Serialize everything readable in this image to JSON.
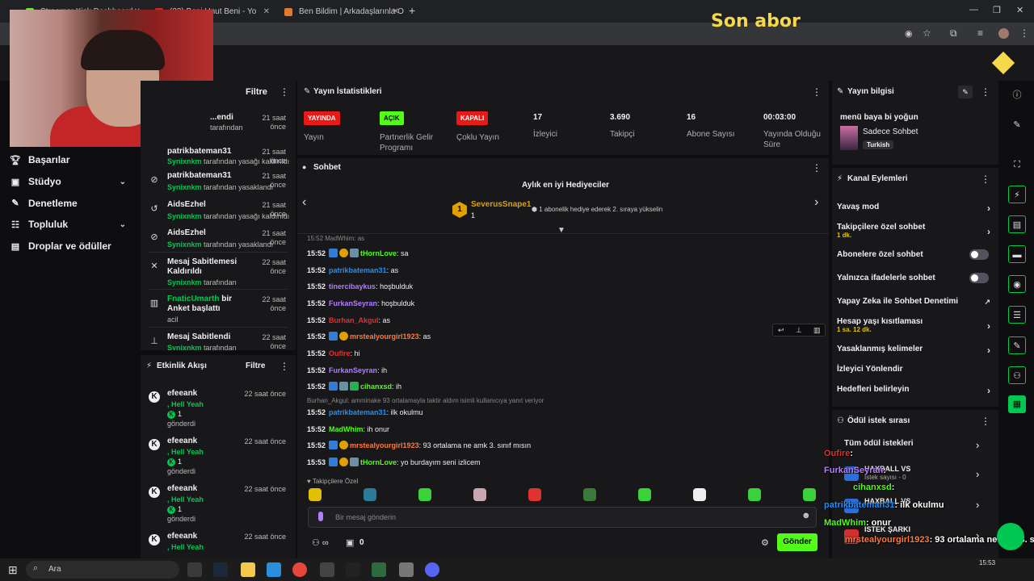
{
  "browser": {
    "tabs": [
      {
        "title": "Streamer Kick Dashboard"
      },
      {
        "title": "(23) Beni Unut Beni - Yo"
      },
      {
        "title": "Ben Bildim | Arkadaşlarınla Onl"
      }
    ],
    "add_tab": "+"
  },
  "overlay_title": "Son abor",
  "left_nav": {
    "items": [
      {
        "label": "Başarılar"
      },
      {
        "label": "Stüdyo"
      },
      {
        "label": "Denetleme"
      },
      {
        "label": "Topluluk"
      },
      {
        "label": "Droplar ve ödüller"
      }
    ]
  },
  "mod_actions": {
    "filter": "Filtre",
    "items": [
      {
        "title": "...endi",
        "time": "21 saat önce",
        "actor": "Synixnkm",
        "suffix": "tarafından"
      },
      {
        "title": "patrikbateman31",
        "time": "21 saat önce",
        "actor": "Synixnkm",
        "suffix": "tarafından yasağı kaldırıldı"
      },
      {
        "title": "patrikbateman31",
        "time": "21 saat önce",
        "actor": "Synixnkm",
        "suffix": "tarafından yasaklandı"
      },
      {
        "title": "AidsEzhel",
        "time": "21 saat önce",
        "actor": "Synixnkm",
        "suffix": "tarafından yasağı kaldırıldı"
      },
      {
        "title": "AidsEzhel",
        "time": "21 saat önce",
        "actor": "Synixnkm",
        "suffix": "tarafından yasaklandı"
      },
      {
        "title": "Mesaj Sabitlemesi Kaldırıldı",
        "time": "22 saat önce",
        "actor": "Synixnkm",
        "suffix": "tarafından"
      },
      {
        "title_green": "FnaticUmarth",
        "title": " bir Anket başlattı",
        "time": "22 saat önce",
        "extra": "acil"
      },
      {
        "title": "Mesaj Sabitlendi",
        "time": "22 saat önce",
        "actor": "Synixnkm",
        "suffix": "tarafından"
      }
    ]
  },
  "activity": {
    "title": "Etkinlik Akışı",
    "filter": "Filtre",
    "items": [
      {
        "name": "efeeank",
        "msg": ", Hell Yeah",
        "amount": "1",
        "label": "gönderdi",
        "time": "22 saat önce"
      },
      {
        "name": "efeeank",
        "msg": ", Hell Yeah",
        "amount": "1",
        "label": "gönderdi",
        "time": "22 saat önce"
      },
      {
        "name": "efeeank",
        "msg": ", Hell Yeah",
        "amount": "1",
        "label": "gönderdi",
        "time": "22 saat önce"
      },
      {
        "name": "efeeank",
        "msg": ", Hell Yeah",
        "amount": "1",
        "label": "gönderdi",
        "time": "22 saat önce"
      }
    ]
  },
  "stats": {
    "title": "Yayın İstatistikleri",
    "items": [
      {
        "badge": "YAYINDA",
        "label": "Yayın",
        "color": "#e91916"
      },
      {
        "badge": "AÇIK",
        "label": "Partnerlik Gelir Programı",
        "color": "#53fc18"
      },
      {
        "badge": "KAPALI",
        "label": "Çoklu Yayın",
        "color": "#e91916"
      },
      {
        "value": "17",
        "label": "İzleyici"
      },
      {
        "value": "3.690",
        "label": "Takipçi"
      },
      {
        "value": "16",
        "label": "Abone Sayısı"
      },
      {
        "value": "00:03:00",
        "label": "Yayında Olduğu Süre"
      }
    ]
  },
  "chat": {
    "title": "Sohbet",
    "gifters_title": "Aylık en iyi Hediyeciler",
    "top_gifter": "SeverusSnape1",
    "top_gifter_count": "1",
    "gifter_note": "1 abonelik hediye ederek 2. sıraya yükselin",
    "partial_top": "15:52 MadWhim: as",
    "messages": [
      {
        "time": "15:52",
        "user": "tHornLove",
        "color": "#53fc18",
        "text": ": sa",
        "badges": [
          "mod",
          "sub",
          "other"
        ]
      },
      {
        "time": "15:52",
        "user": "patrikbateman31",
        "color": "#1e90ff",
        "text": ": as",
        "badges": []
      },
      {
        "time": "15:52",
        "user": "tinercibaykus",
        "color": "#b57cff",
        "text": ": hoşbulduk",
        "badges": []
      },
      {
        "time": "15:52",
        "user": "FurkanSeyran",
        "color": "#b57cff",
        "text": ": hoşbulduk",
        "badges": []
      },
      {
        "time": "15:52",
        "user": "Burhan_Akgul",
        "color": "#e0322f",
        "text": ": as",
        "badges": []
      },
      {
        "time": "15:52",
        "user": "mrstealyourgirl1923",
        "color": "#ff7a3d",
        "text": ": as",
        "badges": [
          "mod",
          "sub"
        ]
      },
      {
        "time": "15:52",
        "user": "Oufire",
        "color": "#e0322f",
        "text": ": hi",
        "badges": []
      },
      {
        "time": "15:52",
        "user": "FurkanSeyran",
        "color": "#b57cff",
        "text": ": ih",
        "badges": []
      },
      {
        "time": "15:52",
        "user": "cihanxsd",
        "color": "#53fc18",
        "text": ": ih",
        "badges": [
          "mod",
          "other",
          "vip"
        ]
      },
      {
        "time": "15:52",
        "user": "patrikbateman31",
        "color": "#1e90ff",
        "text": ": ilk okulmu",
        "badges": [],
        "reply": "Burhan_Akgul: amminake 93 ortalamayla taktir aldım isimli kullanıcıya yanıt veriyor"
      },
      {
        "time": "15:52",
        "user": "MadWhim",
        "color": "#53fc18",
        "text": ": ih onur",
        "badges": []
      },
      {
        "time": "15:52",
        "user": "mrstealyourgirl1923",
        "color": "#ff7a3d",
        "text": ": 93 ortalama ne amk 3. sınıf mısın",
        "badges": [
          "mod",
          "sub"
        ]
      },
      {
        "time": "15:53",
        "user": "tHornLove",
        "color": "#53fc18",
        "text": ": yo burdayım seni izlicem",
        "badges": [
          "mod",
          "sub",
          "other"
        ]
      }
    ],
    "followers_only_label": "Takipçilere Özel",
    "input_placeholder": "Bir mesaj gönderin",
    "points": "0",
    "send": "Gönder"
  },
  "stream_info": {
    "title": "Yayın bilgisi",
    "stream_title": "menü baya bi yoğun",
    "category": "Sadece Sohbet",
    "tag": "Turkish"
  },
  "channel_actions": {
    "title": "Kanal Eylemleri",
    "items": [
      {
        "label": "Yavaş mod",
        "kind": "arrow"
      },
      {
        "label": "Takipçilere özel sohbet",
        "sub": "1 dk.",
        "kind": "arrow"
      },
      {
        "label": "Abonelere özel sohbet",
        "kind": "toggle"
      },
      {
        "label": "Yalnızca ifadelerle sohbet",
        "kind": "toggle"
      },
      {
        "label": "Yapay Zeka ile Sohbet Denetimi",
        "kind": "external"
      },
      {
        "label": "Hesap yaşı kısıtlaması",
        "sub": "1 sa. 12 dk.",
        "kind": "arrow"
      },
      {
        "label": "Yasaklanmış kelimeler",
        "kind": "arrow"
      },
      {
        "label": "İzleyici Yönlendir",
        "kind": "none"
      },
      {
        "label": "Hedefleri belirleyin",
        "kind": "arrow"
      }
    ]
  },
  "rewards": {
    "title": "Ödül istek sırası",
    "all": "Tüm ödül istekleri",
    "rows": [
      {
        "name": "HAXBALL VS",
        "sub": "İstek sayısı - 0"
      },
      {
        "name": "HAXBALL VS",
        "sub": "İstek sayısı - 0"
      },
      {
        "name": "İSTEK ŞARKI",
        "sub": ""
      }
    ]
  },
  "stream_overlay": [
    {
      "user": "Oufire",
      "text": ": ",
      "color": "#e0322f"
    },
    {
      "user": "FurkanSeyran",
      "text": ": ",
      "color": "#b57cff"
    },
    {
      "user": "cihanxsd",
      "text": ": ",
      "color": "#53fc18"
    },
    {
      "user": "patrikbateman31",
      "text": ": ilk okulmu",
      "color": "#1e90ff"
    },
    {
      "user": "MadWhim",
      "text": ": onur",
      "color": "#53fc18"
    },
    {
      "user": "mrstealyourgirl1923",
      "text": ": 93 ortalama ne amk 3. sınıf mısın",
      "color": "#ff7a3d"
    },
    {
      "user": "tHornLove",
      "text": ": yo burdayım seni izlicem",
      "color": "#53fc18"
    }
  ],
  "taskbar": {
    "search": "Ara",
    "clock": "15:53"
  }
}
